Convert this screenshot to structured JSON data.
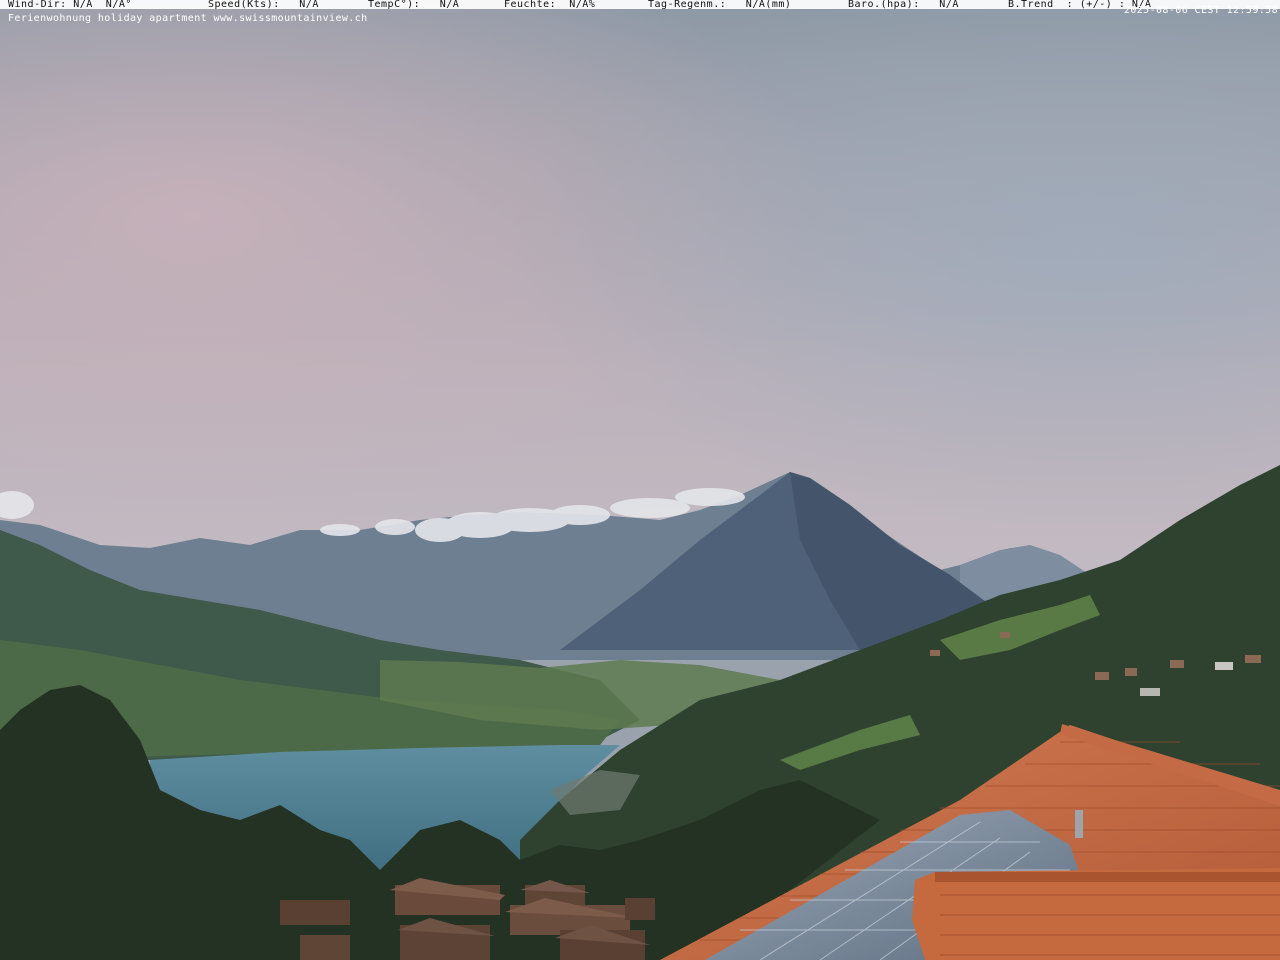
{
  "weather_bar": {
    "wind_dir": "Wind-Dir: N/A  N/A°",
    "speed": "Speed(Kts):   N/A",
    "temp": "TempC°):   N/A",
    "humidity": "Feuchte:  N/A%",
    "rain": "Tag-Regenm.:   N/A(mm)",
    "baro": "Baro.(hpa):   N/A",
    "trend": "B.Trend  : (+/-) : N/A"
  },
  "caption": "Ferienwohnung holiday apartment www.swissmountainview.ch",
  "timestamp": "2025-08-06 CEST 12:59:58",
  "colors": {
    "sky_top": "#8e9aa6",
    "sky_mid": "#b9aeb8",
    "mountain_far": "#55677d",
    "forest": "#2c3a2a",
    "lake": "#4f7f93",
    "roof": "#c2663f",
    "solar": "#7c8c9e"
  }
}
